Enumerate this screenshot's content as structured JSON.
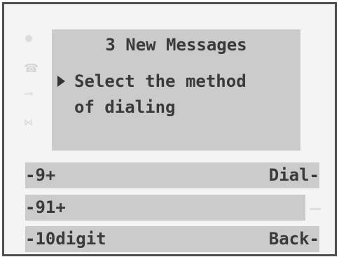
{
  "screen": {
    "title": "3 New Messages",
    "message": "Select the method\nof dialing",
    "side_icons": [
      "circle-icon",
      "phone-icon",
      "key-icon",
      "bowtie-icon"
    ]
  },
  "softkeys": {
    "left": [
      "-9+",
      "-91+",
      "-10digit"
    ],
    "right": [
      "Dial-",
      "",
      "Back-"
    ]
  },
  "colors": {
    "screen_bg": "#cbcbcb",
    "frame_border": "#4f4f4f",
    "text": "#3a3a3a"
  }
}
